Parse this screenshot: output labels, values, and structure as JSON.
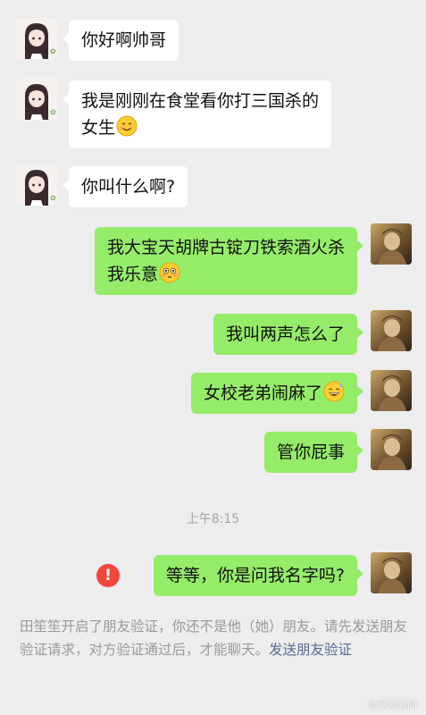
{
  "messages": [
    {
      "from": "other",
      "lines": [
        "你好啊帅哥"
      ]
    },
    {
      "from": "other",
      "lines": [
        "我是刚刚在食堂看你打三国杀的",
        "女生"
      ],
      "emoji": "smile-emoji"
    },
    {
      "from": "other",
      "lines": [
        "你叫什么啊?"
      ]
    },
    {
      "from": "me",
      "lines": [
        "我大宝天胡牌古锭刀铁索酒火杀",
        "我乐意"
      ],
      "emoji": "flushed-emoji"
    },
    {
      "from": "me",
      "lines": [
        "我叫两声怎么了"
      ]
    },
    {
      "from": "me",
      "lines": [
        "女校老弟闹麻了"
      ],
      "emoji": "sweat-smile-emoji"
    },
    {
      "from": "me",
      "lines": [
        "管你屁事"
      ]
    },
    {
      "from": "me",
      "lines": [
        "等等，你是问我名字吗?"
      ],
      "failed": true
    }
  ],
  "timestamp": "上午8:15",
  "error_mark": "!",
  "system_note": {
    "text": "田笙笙开启了朋友验证，你还不是他（她）朋友。请先发送朋友验证请求，对方验证通过后，才能聊天。",
    "link": "发送朋友验证"
  },
  "watermark": "@网易新闻",
  "colors": {
    "background": "#ededed",
    "sent_bubble": "#95ec69",
    "received_bubble": "#ffffff",
    "error": "#f2463d",
    "link": "#576b95"
  }
}
